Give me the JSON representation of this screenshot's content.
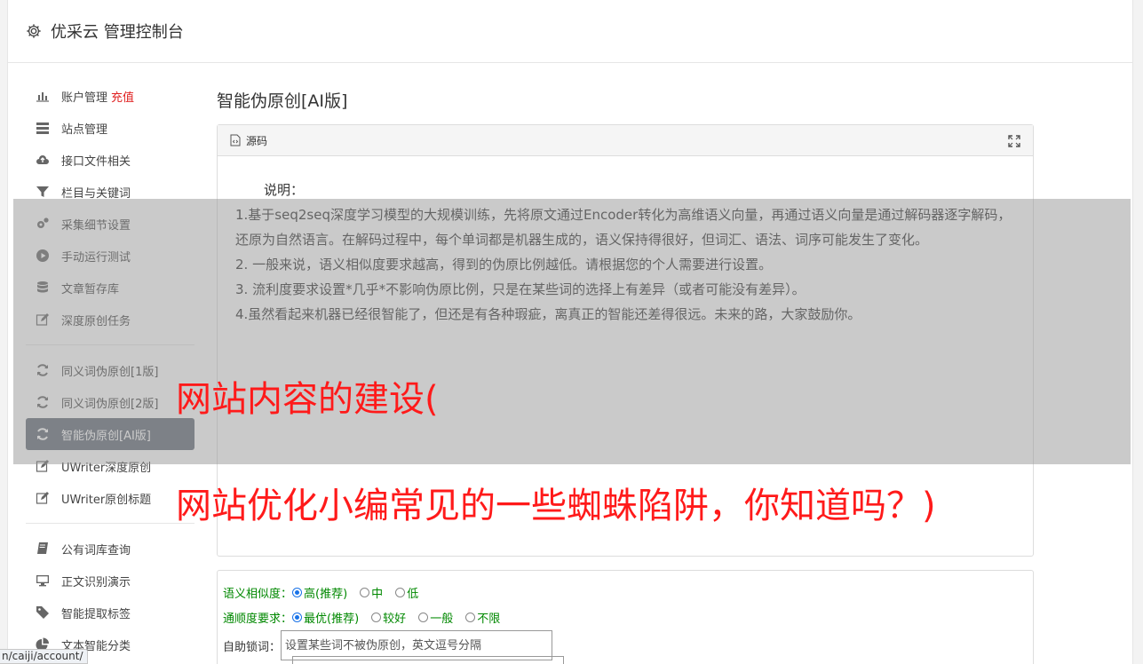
{
  "header": {
    "title": "优采云 管理控制台",
    "icon": "gear-icon"
  },
  "sidebar": {
    "group1": [
      {
        "label": "账户管理",
        "badge": "充值",
        "icon": "bar-chart-icon"
      },
      {
        "label": "站点管理",
        "icon": "server-icon"
      },
      {
        "label": "接口文件相关",
        "icon": "cloud-upload-icon"
      },
      {
        "label": "栏目与关键词",
        "icon": "filter-icon"
      },
      {
        "label": "采集细节设置",
        "icon": "gears-icon"
      },
      {
        "label": "手动运行测试",
        "icon": "play-circle-icon"
      },
      {
        "label": "文章暂存库",
        "icon": "database-icon"
      },
      {
        "label": "深度原创任务",
        "icon": "edit-icon"
      }
    ],
    "group2": [
      {
        "label": "同义词伪原创[1版]",
        "icon": "refresh-icon"
      },
      {
        "label": "同义词伪原创[2版]",
        "icon": "refresh-icon"
      },
      {
        "label": "智能伪原创[AI版]",
        "icon": "refresh-icon",
        "active": true
      },
      {
        "label": "UWriter深度原创",
        "icon": "edit-icon"
      },
      {
        "label": "UWriter原创标题",
        "icon": "edit-icon"
      }
    ],
    "group3": [
      {
        "label": "公有词库查询",
        "icon": "book-icon"
      },
      {
        "label": "正文识别演示",
        "icon": "desktop-icon"
      },
      {
        "label": "智能提取标签",
        "icon": "tag-icon"
      },
      {
        "label": "文本智能分类",
        "icon": "pie-chart-icon"
      }
    ]
  },
  "main": {
    "page_title": "智能伪原创[AI版]",
    "panel": {
      "title": "源码",
      "lead": "说明：",
      "lines": [
        "1.基于seq2seq深度学习模型的大规模训练，先将原文通过Encoder转化为高维语义向量，再通过语义向量是通过解码器逐字解码，还原为自然语言。在解码过程中，每个单词都是机器生成的，语义保持得很好，但词汇、语法、词序可能发生了变化。",
        "2. 一般来说，语义相似度要求越高，得到的伪原比例越低。请根据您的个人需要进行设置。",
        "3. 流利度要求设置*几乎*不影响伪原比例，只是在某些词的选择上有差异（或者可能没有差异）。",
        "4.虽然看起来机器已经很智能了，但还是有各种瑕疵，离真正的智能还差得很远。未来的路，大家鼓励你。"
      ]
    },
    "form": {
      "similarity_label": "语义相似度：",
      "similarity_options": [
        "高(推荐)",
        "中",
        "低"
      ],
      "fluency_label": "通顺度要求：",
      "fluency_options": [
        "最优(推荐)",
        "较好",
        "一般",
        "不限"
      ],
      "lock_label": "自助锁词：",
      "lock_placeholder": "设置某些词不被伪原创，英文逗号分隔"
    }
  },
  "promo": {
    "line1": "网站内容的建设(",
    "line2": "网站优化小编常见的一些蜘蛛陷阱，你知道吗？)"
  },
  "statusbar": {
    "url": "n/caiji/account/"
  },
  "colors": {
    "active_bg": "#656d78",
    "promo_red": "#ff1a1a",
    "form_green": "#008800",
    "badge_red": "#e02020"
  }
}
